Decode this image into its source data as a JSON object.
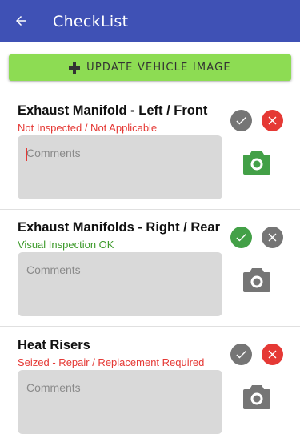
{
  "app": {
    "title": "CheckList"
  },
  "update_button": {
    "label": "UPDATE VEHICLE IMAGE"
  },
  "colors": {
    "appbar": "#3f51b5",
    "update_button": "#8ddc53",
    "status_red": "#e53935",
    "status_green": "#3d9a2b",
    "check_active": "#43a047",
    "x_active": "#e53935",
    "inactive": "#757575",
    "camera_active": "#43a047"
  },
  "items": [
    {
      "title": "Exhaust Manifold - Left / Front",
      "status": "Not Inspected / Not Applicable",
      "status_color": "red",
      "comments_placeholder": "Comments",
      "check_state": "inactive",
      "x_state": "active",
      "camera_state": "active"
    },
    {
      "title": "Exhaust Manifolds - Right / Rear",
      "status": "Visual Inspection OK",
      "status_color": "green",
      "comments_placeholder": "Comments",
      "check_state": "active",
      "x_state": "inactive",
      "camera_state": "inactive"
    },
    {
      "title": "Heat Risers",
      "status": "Seized - Repair / Replacement Required",
      "status_color": "red",
      "comments_placeholder": "Comments",
      "check_state": "inactive",
      "x_state": "active",
      "camera_state": "inactive"
    }
  ]
}
